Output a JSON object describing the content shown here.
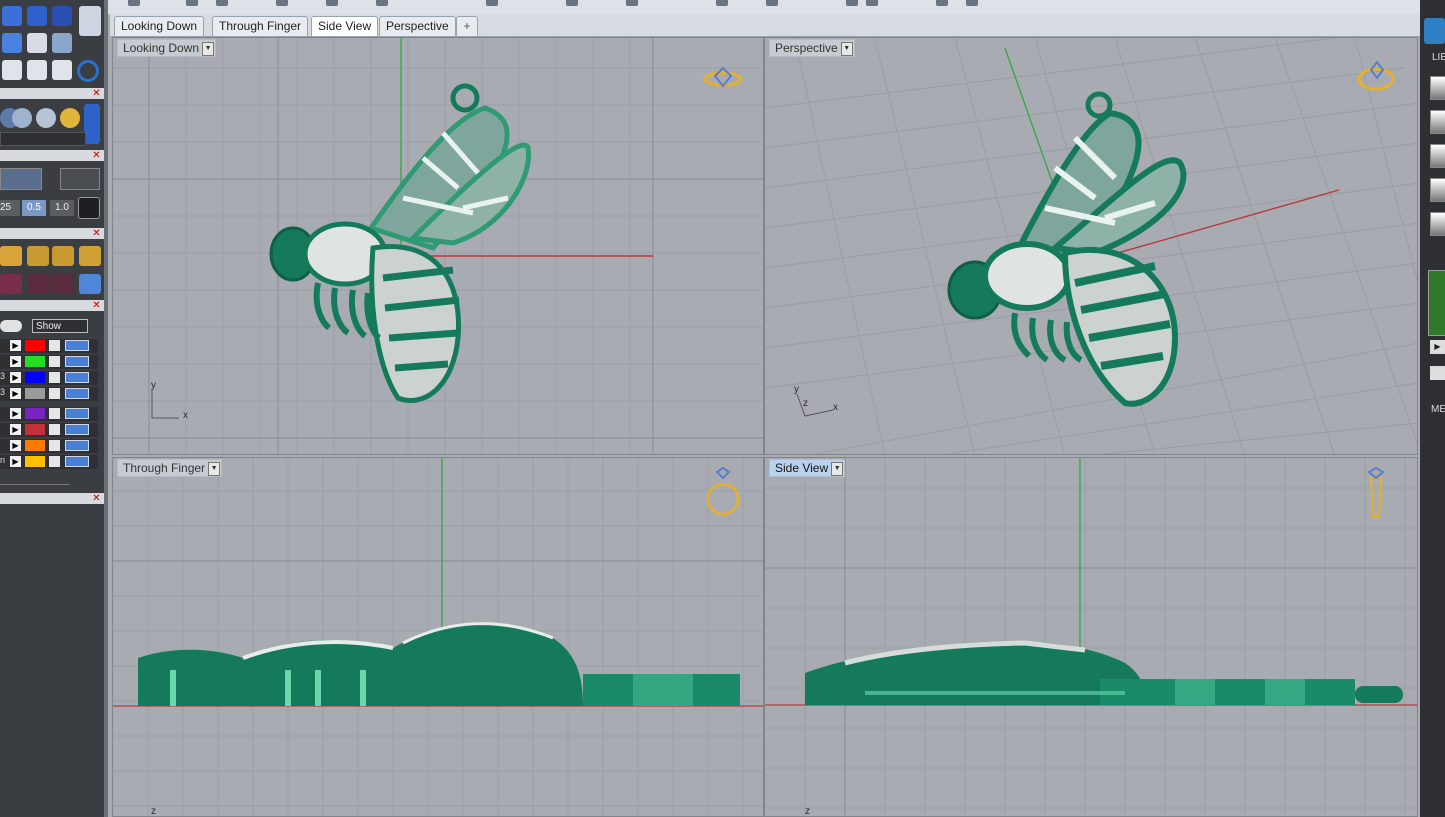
{
  "tabs": [
    {
      "label": "Looking Down",
      "active": false
    },
    {
      "label": "Through Finger",
      "active": false
    },
    {
      "label": "Side View",
      "active": true
    },
    {
      "label": "Perspective",
      "active": false
    }
  ],
  "add_tab_icon": "plus-icon",
  "viewports": {
    "top_left": {
      "label": "Looking Down",
      "axis_y": "y",
      "axis_x": "x",
      "widget_icon": "ring-top-icon"
    },
    "top_right": {
      "label": "Perspective",
      "axis_y": "y",
      "axis_z": "z",
      "axis_x": "x",
      "widget_icon": "ring-perspective-icon"
    },
    "bottom_left": {
      "label": "Through Finger",
      "axis_z": "z",
      "widget_icon": "ring-front-icon"
    },
    "bottom_right": {
      "label": "Side View",
      "axis_z": "z",
      "widget_icon": "ring-side-icon"
    }
  },
  "left_panel": {
    "snap_values": [
      "25",
      "0.5",
      "1.0"
    ],
    "show_label": "Show",
    "layer_colors": [
      "#ff0000",
      "#22dd22",
      "#0000ff",
      "#9a9a9a",
      "#7a22c2",
      "#c2313a",
      "#ff7a00",
      "#ffc000"
    ],
    "layer_prefixes": [
      "",
      "",
      "3",
      "3",
      "",
      "",
      "",
      "n"
    ]
  },
  "right_panel": {
    "label_li": "LIE",
    "label_me": "ME"
  },
  "colors": {
    "model_green": "#157a5c",
    "x_axis": "#b83a3a",
    "y_axis": "#3aa64a",
    "widget_gold": "#e8b02a"
  }
}
